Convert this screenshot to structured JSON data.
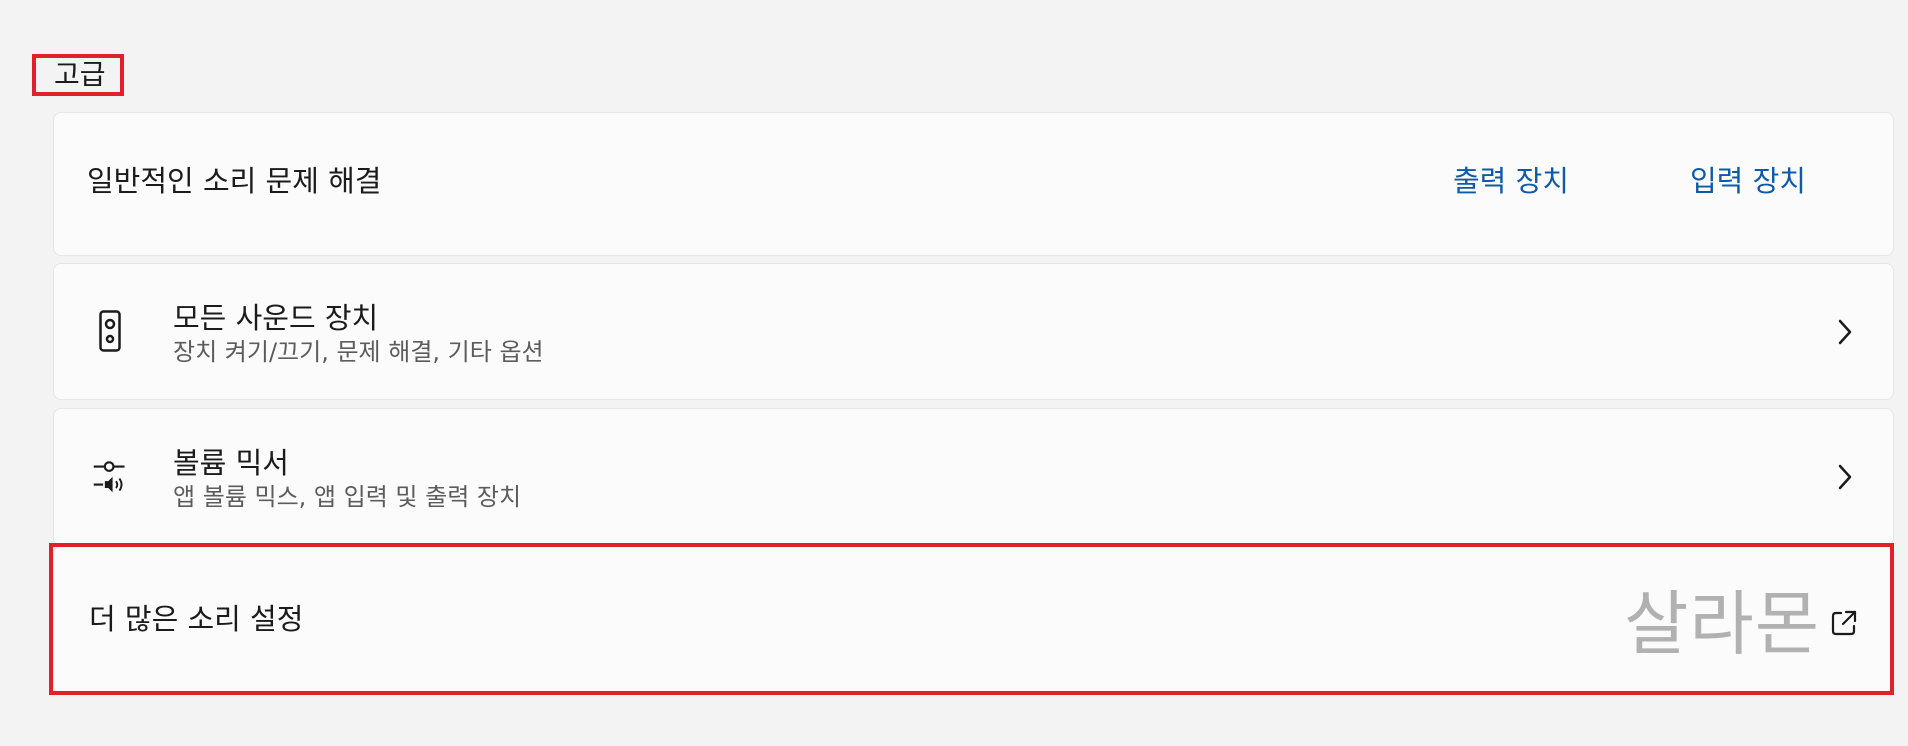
{
  "section": {
    "title": "고급"
  },
  "troubleshoot": {
    "label": "일반적인 소리 문제 해결",
    "output_link": "출력 장치",
    "input_link": "입력 장치"
  },
  "all_devices": {
    "title": "모든 사운드 장치",
    "subtitle": "장치 켜기/끄기, 문제 해결, 기타 옵션",
    "icon": "speaker-icon"
  },
  "mixer": {
    "title": "볼륨 믹서",
    "subtitle": "앱 볼륨 믹스, 앱 입력 및 출력 장치",
    "icon": "volume-mixer-icon"
  },
  "more_sound": {
    "label": "더 많은 소리 설정",
    "icon": "external-link-icon"
  },
  "watermark": {
    "text": "살라몬"
  },
  "colors": {
    "accent": "#0f5aa6",
    "highlight": "#e0202a",
    "background": "#f3f3f3",
    "card": "#fbfbfb"
  }
}
